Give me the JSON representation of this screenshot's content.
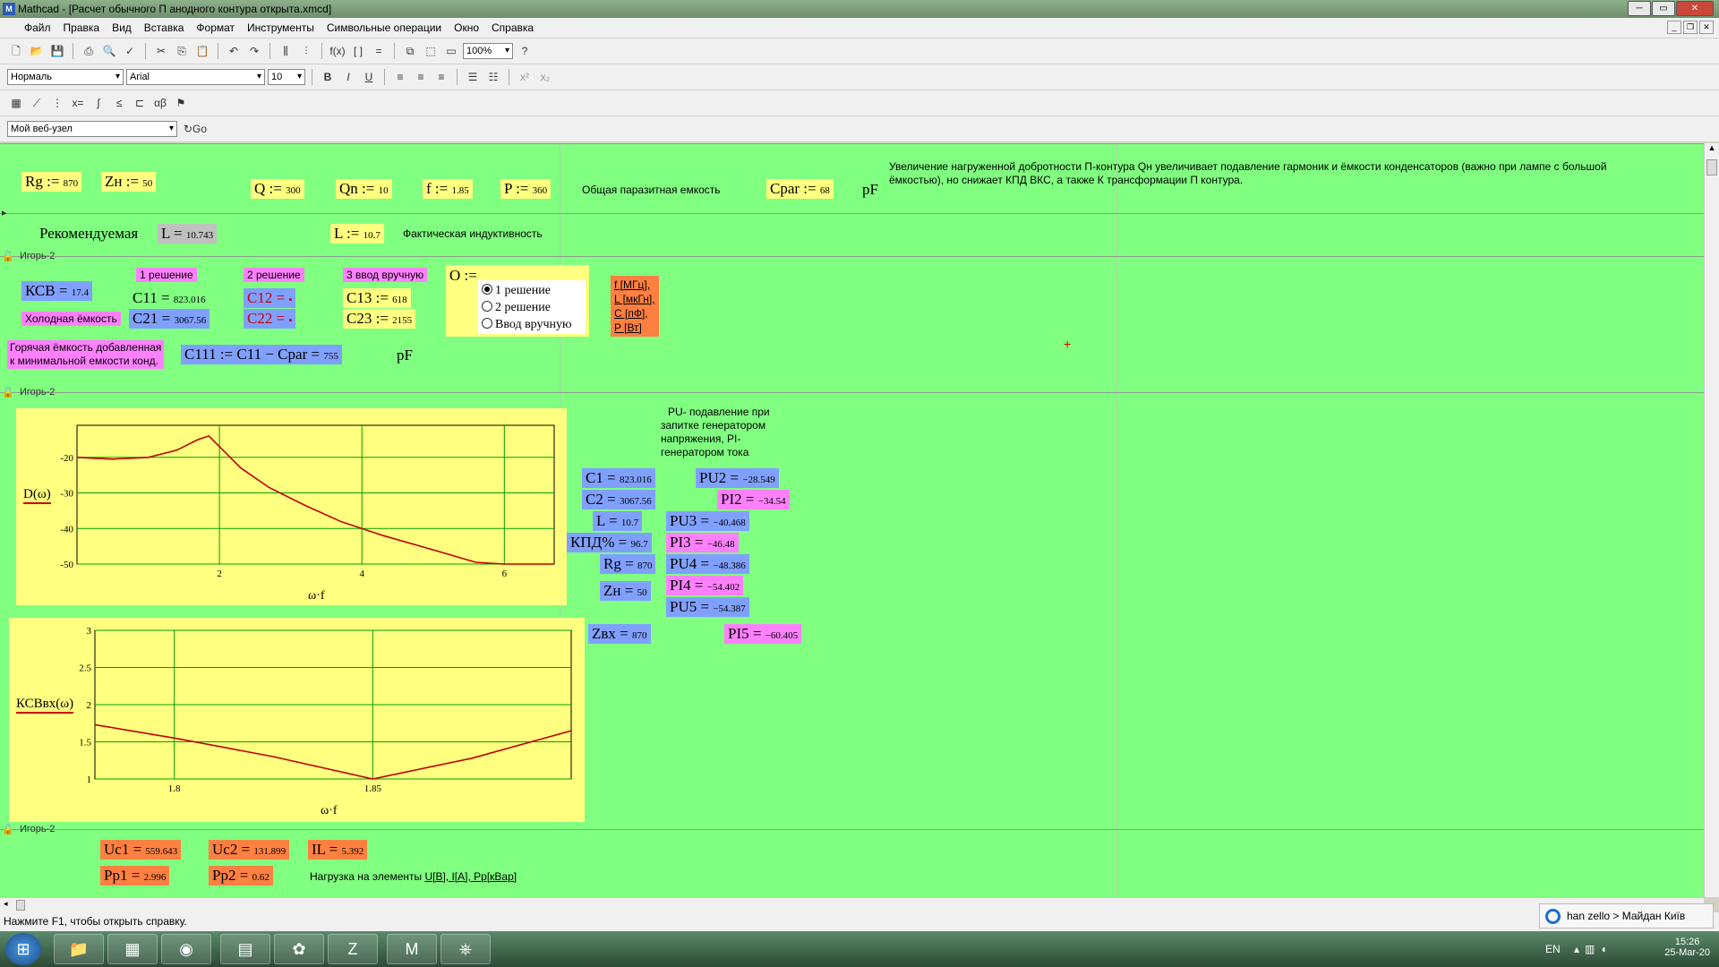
{
  "window": {
    "title": "Mathcad - [Расчет обычного П анодного контура открыта.xmcd]",
    "app_icon": "M"
  },
  "menu": [
    "Файл",
    "Правка",
    "Вид",
    "Вставка",
    "Формат",
    "Инструменты",
    "Символьные операции",
    "Окно",
    "Справка"
  ],
  "toolbar": {
    "zoom": "100%",
    "style": "Нормаль",
    "font": "Arial",
    "size": "10",
    "web": "Мой веб-узел",
    "go": "Go"
  },
  "status": "Нажмите F1, чтобы открыть справку.",
  "zello": "han zello > Майдан Київ",
  "tray": {
    "lang": "EN",
    "time": "15:26",
    "date": "25-Mar-20"
  },
  "sheet": {
    "rg": {
      "label": "Rg",
      "op": ":=",
      "val": "870"
    },
    "zn": {
      "label": "Zн",
      "op": ":=",
      "val": "50"
    },
    "q": {
      "label": "Q",
      "op": ":=",
      "val": "300"
    },
    "qn": {
      "label": "Qn",
      "op": ":=",
      "val": "10"
    },
    "f": {
      "label": "f",
      "op": ":=",
      "val": "1.85"
    },
    "p": {
      "label": "P",
      "op": ":=",
      "val": "360"
    },
    "cpar_text": "Общая паразитная емкость",
    "cpar": {
      "label": "Cpar",
      "op": ":=",
      "val": "68"
    },
    "pf": "pF",
    "note": "Увеличение нагруженной добротности П-контура Qн увеличивает подавление гармоник и ёмкости конденсаторов (важно при лампе с большой ёмкостью), но снижает КПД ВКС, а также К трансформации П контура.",
    "recommended": "Рекомендуемая",
    "lrec": {
      "label": "L",
      "op": "=",
      "val": "10.743"
    },
    "lfact": {
      "label": "L",
      "op": ":=",
      "val": "10.7"
    },
    "lfact_text": "Фактическая индуктивность",
    "region_label": "Игорь-2",
    "sol1": "1 решение",
    "sol2": "2 решение",
    "sol3": "3 ввод вручную",
    "ksv": {
      "label": "КСВ",
      "op": "=",
      "val": "17.4"
    },
    "c11": {
      "label": "C11",
      "op": "=",
      "val": "823.016"
    },
    "c12": {
      "label": "C12",
      "op": "=",
      "val": "▪"
    },
    "c13": {
      "label": "C13",
      "op": ":=",
      "val": "618"
    },
    "cold": "Холодная ёмкость",
    "c21": {
      "label": "C21",
      "op": "=",
      "val": "3067.56"
    },
    "c22": {
      "label": "C22",
      "op": "=",
      "val": "▪"
    },
    "c23": {
      "label": "C23",
      "op": ":=",
      "val": "2155"
    },
    "o": {
      "label": "O",
      "op": ":="
    },
    "radio": [
      "1 решение",
      "2 решение",
      "Ввод вручную"
    ],
    "units": [
      "f [МГц],",
      "L [мкГн],",
      "C [пФ],",
      "P [Вт]"
    ],
    "hot1": "Горячая ёмкость добавленная",
    "hot2": "к минимальной емкости конд.",
    "c111": {
      "label": "C111 := C11 − Cpar",
      "op": "=",
      "val": "755"
    },
    "pf2": "pF",
    "pu_note": [
      "PU- подавление при",
      "запитке генератором",
      "напряжения, PI-",
      "генератором тока"
    ],
    "c1": {
      "label": "C1",
      "op": "=",
      "val": "823.016"
    },
    "c2": {
      "label": "C2",
      "op": "=",
      "val": "3067.56"
    },
    "l": {
      "label": "L",
      "op": "=",
      "val": "10.7"
    },
    "kpd": {
      "label": "КПД%",
      "op": "=",
      "val": "96.7"
    },
    "rg2": {
      "label": "Rg",
      "op": "=",
      "val": "870"
    },
    "zn2": {
      "label": "Zн",
      "op": "=",
      "val": "50"
    },
    "zvx": {
      "label": "Zвх",
      "op": "=",
      "val": "870"
    },
    "pu2": {
      "label": "PU2",
      "op": "=",
      "val": "−28.549"
    },
    "pi2": {
      "label": "PI2",
      "op": "=",
      "val": "−34.54"
    },
    "pu3": {
      "label": "PU3",
      "op": "=",
      "val": "−40.468"
    },
    "pi3": {
      "label": "PI3",
      "op": "=",
      "val": "−46.48"
    },
    "pu4": {
      "label": "PU4",
      "op": "=",
      "val": "−48.386"
    },
    "pi4": {
      "label": "PI4",
      "op": "=",
      "val": "−54.402"
    },
    "pu5": {
      "label": "PU5",
      "op": "=",
      "val": "−54.387"
    },
    "pi5": {
      "label": "PI5",
      "op": "=",
      "val": "−60.405"
    },
    "uc1": {
      "label": "Uc1",
      "op": "=",
      "val": "559.643"
    },
    "uc2": {
      "label": "Uc2",
      "op": "=",
      "val": "131.899"
    },
    "il": {
      "label": "IL",
      "op": "=",
      "val": "5.392"
    },
    "pp1": {
      "label": "Pp1",
      "op": "=",
      "val": "2.996"
    },
    "pp2": {
      "label": "Pp2",
      "op": "=",
      "val": "0.62"
    },
    "load_text": "Нагрузка на элементы",
    "load_link": "U[В], I[А], Pp[кВар]"
  },
  "chart_data": [
    {
      "type": "line",
      "ylabel": "D(ω)",
      "xlabel": "ω·f",
      "xlim": [
        0,
        6.7
      ],
      "ylim": [
        -50,
        -11
      ],
      "xticks": [
        2,
        4,
        6
      ],
      "yticks": [
        -20,
        -30,
        -40,
        -50
      ],
      "series": [
        {
          "x": [
            0,
            0.5,
            1,
            1.4,
            1.7,
            1.85,
            2.0,
            2.3,
            2.7,
            3.2,
            3.7,
            4.3,
            5.0,
            5.6,
            6.0,
            6.7
          ],
          "y": [
            -20,
            -20.5,
            -20,
            -18,
            -15,
            -14,
            -17,
            -23,
            -28.5,
            -33.5,
            -38,
            -42,
            -46,
            -49.5,
            -51,
            -53
          ]
        }
      ],
      "grid": true,
      "color": "#c00000"
    },
    {
      "type": "line",
      "ylabel": "КСВвх(ω)",
      "xlabel": "ω·f",
      "xlim": [
        1.78,
        1.9
      ],
      "ylim": [
        1,
        3
      ],
      "xticks": [
        1.8,
        1.85
      ],
      "yticks": [
        1,
        1.5,
        2,
        2.5,
        3
      ],
      "series": [
        {
          "x": [
            1.78,
            1.8,
            1.825,
            1.85,
            1.875,
            1.9
          ],
          "y": [
            1.73,
            1.55,
            1.3,
            1.0,
            1.28,
            1.65
          ]
        }
      ],
      "grid": true,
      "color": "#c00000"
    }
  ]
}
